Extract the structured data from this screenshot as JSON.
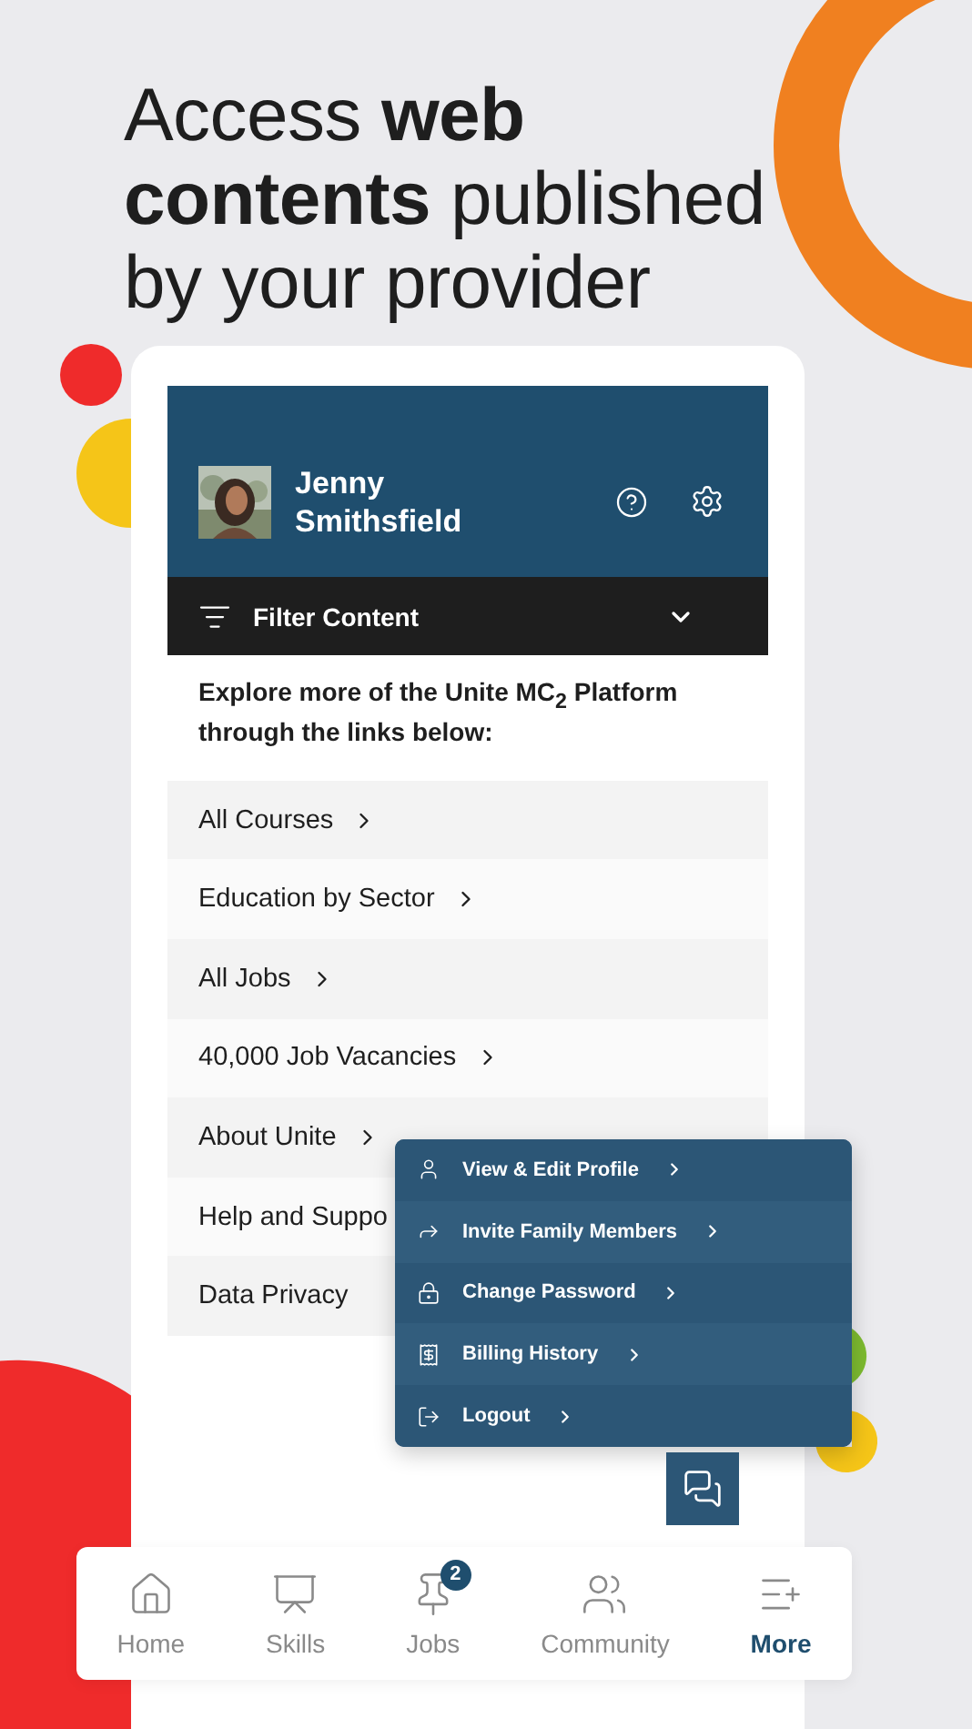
{
  "headline": "Access **web contents** published by your provider",
  "profile": {
    "name": "Jenny Smithsfield"
  },
  "filter": {
    "label": "Filter Content",
    "expanded": false
  },
  "intro": "Explore more of the Unite MC$_{2}$ Platform through the links below:",
  "links": [
    {
      "label": "All Courses",
      "chevron": true
    },
    {
      "label": "Education by Sector",
      "chevron": true
    },
    {
      "label": "All Jobs",
      "chevron": true
    },
    {
      "label": "40,000 Job Vacancies",
      "chevron": true
    },
    {
      "label": "About Unite",
      "chevron": true
    },
    {
      "label": "Help and Suppo"
    },
    {
      "label": "Data Privacy"
    }
  ],
  "menu": [
    {
      "label": "View & Edit Profile"
    },
    {
      "label": "Invite Family Members"
    },
    {
      "label": "Change Password"
    },
    {
      "label": "Billing History"
    },
    {
      "label": "Logout"
    }
  ],
  "tabs": [
    {
      "label": "Home",
      "selected": false
    },
    {
      "label": "Skills",
      "selected": false
    },
    {
      "label": "Jobs",
      "selected": false,
      "badge": "2"
    },
    {
      "label": "Community",
      "selected": false
    },
    {
      "label": "More",
      "selected": true
    }
  ]
}
